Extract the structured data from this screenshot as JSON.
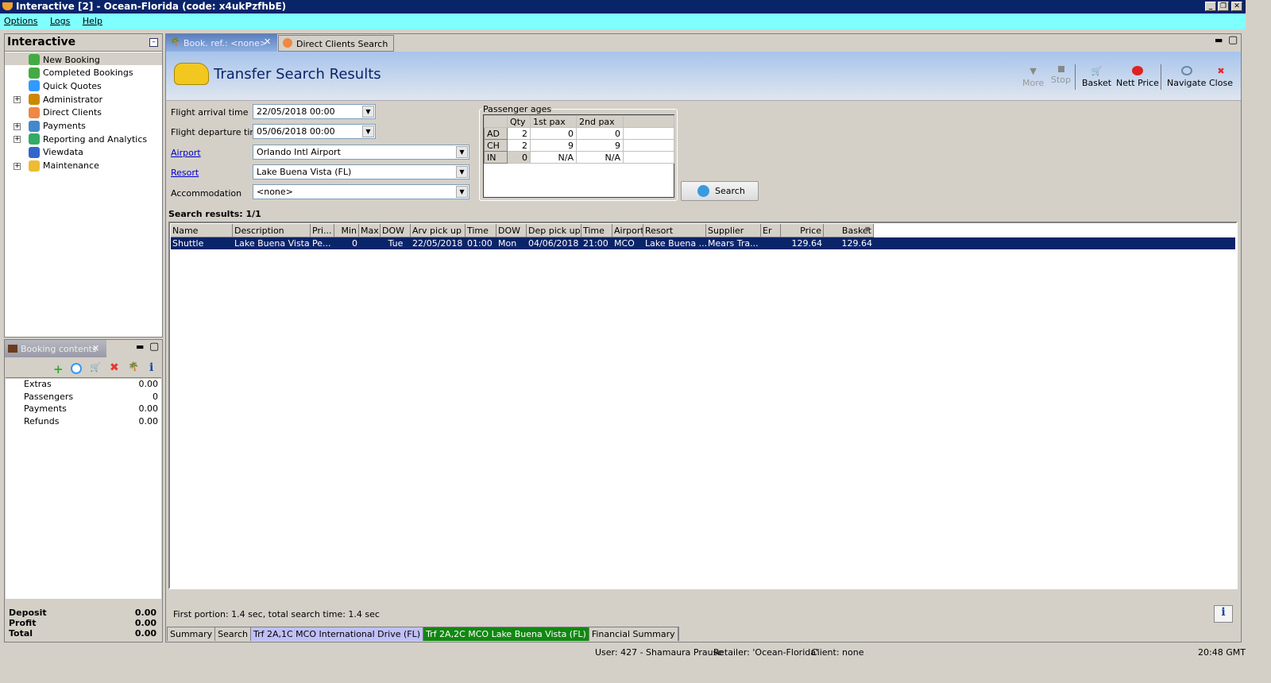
{
  "window": {
    "title": "Interactive [2] - Ocean-Florida (code: x4ukPzfhbE)"
  },
  "menu": [
    "Options",
    "Logs",
    "Help"
  ],
  "sidebar": {
    "title": "Interactive",
    "items": [
      {
        "label": "New Booking",
        "expandable": false
      },
      {
        "label": "Completed Bookings",
        "expandable": false
      },
      {
        "label": "Quick Quotes",
        "expandable": false
      },
      {
        "label": "Administrator",
        "expandable": true
      },
      {
        "label": "Direct Clients",
        "expandable": false
      },
      {
        "label": "Payments",
        "expandable": true
      },
      {
        "label": "Reporting and Analytics",
        "expandable": true
      },
      {
        "label": "Viewdata",
        "expandable": false
      },
      {
        "label": "Maintenance",
        "expandable": true
      }
    ]
  },
  "booking_contents": {
    "title": "Booking contents",
    "rows": [
      {
        "label": "Extras",
        "value": "0.00"
      },
      {
        "label": "Passengers",
        "value": "0"
      },
      {
        "label": "Payments",
        "value": "0.00"
      },
      {
        "label": "Refunds",
        "value": "0.00"
      }
    ],
    "totals": [
      {
        "label": "Deposit",
        "value": "0.00"
      },
      {
        "label": "Profit",
        "value": "0.00"
      },
      {
        "label": "Total",
        "value": "0.00"
      }
    ]
  },
  "tabs": [
    "Book. ref.: <none>",
    "Direct Clients Search"
  ],
  "page": {
    "title": "Transfer Search Results"
  },
  "toolbar": [
    "More",
    "Stop",
    "Basket",
    "Nett Price",
    "Navigate",
    "Close"
  ],
  "form": {
    "arrival_label": "Flight arrival time",
    "arrival": "22/05/2018 00:00",
    "departure_label": "Flight departure time",
    "departure": "05/06/2018 00:00",
    "airport_label": "Airport",
    "airport": "Orlando Intl Airport",
    "resort_label": "Resort",
    "resort": "Lake Buena Vista (FL)",
    "accommodation_label": "Accommodation",
    "accommodation": "<none>",
    "search_label": "Search"
  },
  "passenger_ages": {
    "title": "Passenger ages",
    "headers": [
      "Qty",
      "1st pax",
      "2nd pax"
    ],
    "rows": [
      [
        "AD",
        "2",
        "0",
        "0"
      ],
      [
        "CH",
        "2",
        "9",
        "9"
      ],
      [
        "IN",
        "0",
        "N/A",
        "N/A"
      ]
    ]
  },
  "results": {
    "title": "Search results: 1/1",
    "columns": [
      "Name",
      "Description",
      "Pri...",
      "Min",
      "Max",
      "DOW",
      "Arv pick up",
      "Time",
      "DOW",
      "Dep pick up",
      "Time",
      "Airport",
      "Resort",
      "Supplier",
      "Er",
      "Price",
      "Basket"
    ],
    "rows": [
      [
        "Shuttle",
        "Lake Buena Vista...",
        "Pe...",
        "0",
        "",
        "Tue",
        "22/05/2018",
        "01:00",
        "Mon",
        "04/06/2018",
        "21:00",
        "MCO",
        "Lake Buena ...",
        "Mears Tra...",
        "",
        "129.64",
        "129.64"
      ]
    ]
  },
  "timing": "First portion: 1.4 sec, total search time: 1.4 sec",
  "bottom_tabs": [
    "Summary",
    "Search",
    "Trf 2A,1C MCO International Drive (FL)",
    "Trf 2A,2C MCO Lake Buena Vista (FL)",
    "Financial Summary"
  ],
  "status": {
    "user": "User: 427 - Shamaura Prause",
    "retailer": "Retailer: 'Ocean-Florida'",
    "client": "Client: none",
    "time": "20:48 GMT"
  }
}
